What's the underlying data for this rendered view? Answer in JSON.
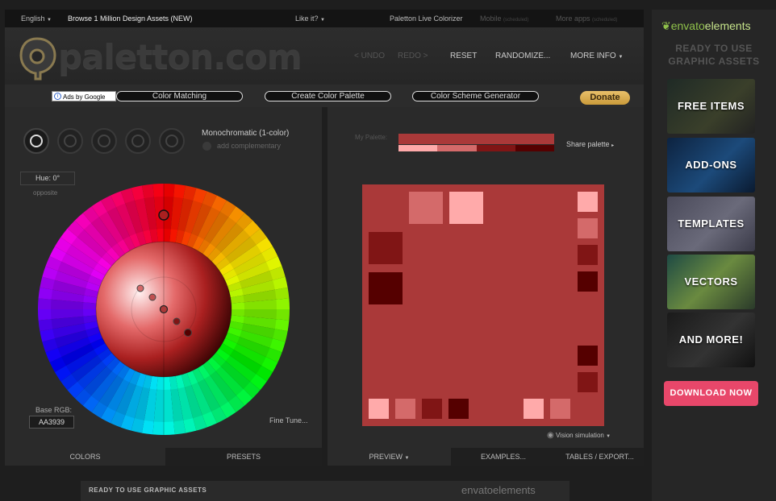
{
  "topbar": {
    "language": "English",
    "browse": "Browse 1 Million Design Assets (NEW)",
    "like": "Like it?",
    "live": "Paletton Live Colorizer",
    "mobile": "Mobile",
    "mobile_tag": "(scheduled)",
    "moreapps": "More apps",
    "moreapps_tag": "(scheduled)"
  },
  "header": {
    "logo": "paletton",
    "logo_suffix": ".com",
    "undo": "< UNDO",
    "redo": "REDO >",
    "reset": "RESET",
    "randomize": "RANDOMIZE...",
    "moreinfo": "MORE INFO"
  },
  "buttons": {
    "ads": "Ads by Google",
    "color_matching": "Color Matching",
    "create_palette": "Create Color Palette",
    "scheme_generator": "Color Scheme Generator",
    "donate": "Donate"
  },
  "left": {
    "scheme_name": "Monochromatic (1-color)",
    "add_complementary": "add complementary",
    "hue": "Hue: 0°",
    "opposite": "opposite",
    "base_rgb_label": "Base RGB:",
    "base_rgb": "AA3939",
    "fine_tune": "Fine Tune...",
    "tabs": [
      "COLORS",
      "PRESETS"
    ]
  },
  "right": {
    "my_palette": "My Palette:",
    "share": "Share palette",
    "vision": "Vision simulation",
    "tabs": [
      "PREVIEW",
      "EXAMPLES...",
      "TABLES / EXPORT..."
    ]
  },
  "colors": {
    "base": "#aa3939",
    "light2": "#ffaaaa",
    "light1": "#d46a6a",
    "dark1": "#801515",
    "dark2": "#550000"
  },
  "bottom": {
    "text": "READY TO USE GRAPHIC ASSETS",
    "brand": "envatoelements"
  },
  "sidebar": {
    "brand_light": "envato",
    "brand_bold": "elements",
    "ready_line1": "READY TO USE",
    "ready_line2": "GRAPHIC ASSETS",
    "tiles": [
      "FREE ITEMS",
      "ADD-ONS",
      "TEMPLATES",
      "VECTORS",
      "AND MORE!"
    ],
    "download": "DOWNLOAD NOW"
  }
}
